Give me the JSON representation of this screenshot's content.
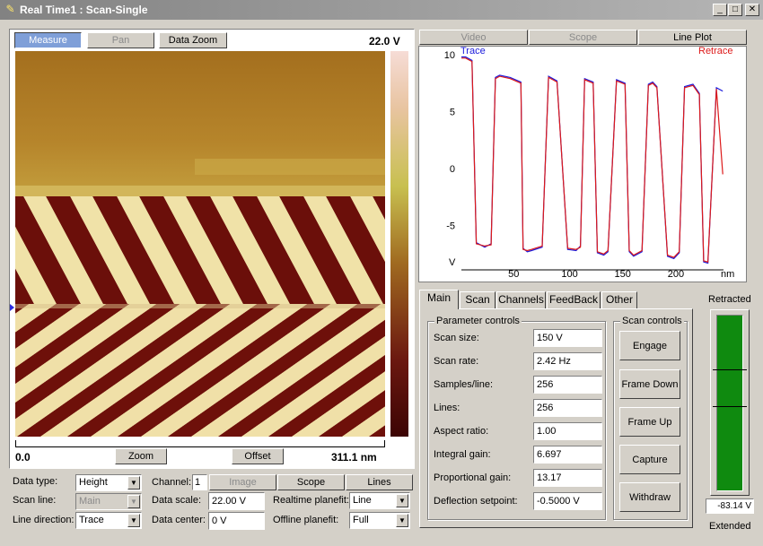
{
  "window": {
    "title": "Real Time1 : Scan-Single",
    "controls": {
      "minimize": "_",
      "maximize": "□",
      "close": "✕"
    }
  },
  "image_panel": {
    "buttons": [
      "Measure",
      "Pan",
      "Data Zoom"
    ],
    "scale_top": "22.0 V",
    "x_start": "0.0",
    "x_end": "311.1 nm",
    "zoom_button": "Zoom",
    "offset_button": "Offset"
  },
  "bottom_controls": {
    "data_type": {
      "label": "Data type:",
      "value": "Height"
    },
    "scan_line": {
      "label": "Scan line:",
      "value": "Main"
    },
    "line_direction": {
      "label": "Line direction:",
      "value": "Trace"
    },
    "channel": {
      "label": "Channel:",
      "value": "1"
    },
    "buttons": [
      "Image",
      "Scope",
      "Lines"
    ],
    "data_scale": {
      "label": "Data scale:",
      "value": "22.00 V"
    },
    "data_center": {
      "label": "Data center:",
      "value": "0 V"
    },
    "realtime_planefit": {
      "label": "Realtime planefit:",
      "value": "Line"
    },
    "offline_planefit": {
      "label": "Offline planefit:",
      "value": "Full"
    }
  },
  "plot_panel": {
    "view_tabs": [
      "Video",
      "Scope",
      "Line Plot"
    ],
    "trace_label": "Trace",
    "retrace_label": "Retrace",
    "x_unit": "nm"
  },
  "chart_data": {
    "type": "line",
    "xlabel": "nm",
    "ylabel": "V",
    "xlim": [
      0,
      311.1
    ],
    "ylim": [
      -8.5,
      10
    ],
    "x_ticks": [
      50,
      100,
      150,
      200
    ],
    "y_ticks": [
      10,
      5,
      0,
      -5
    ],
    "legend": "top",
    "colors": {
      "trace": "#1a1adc",
      "retrace": "#dd1a1a"
    },
    "series": [
      {
        "name": "Trace",
        "x": [
          0,
          4,
          10,
          14,
          22,
          28,
          32,
          36,
          46,
          56,
          58,
          62,
          66,
          76,
          82,
          86,
          90,
          100,
          108,
          112,
          116,
          124,
          128,
          134,
          138,
          146,
          154,
          158,
          162,
          170,
          176,
          180,
          184,
          194,
          200,
          205,
          210,
          218,
          224,
          228,
          232,
          240,
          246
        ],
        "y": [
          9.8,
          9.8,
          9.5,
          -6.5,
          -6.9,
          -6.6,
          8.0,
          8.2,
          8.0,
          7.6,
          -7.0,
          -7.3,
          -7.2,
          -6.9,
          8.1,
          7.9,
          7.7,
          -7.1,
          -7.2,
          -6.8,
          7.9,
          7.6,
          -7.4,
          -7.6,
          -7.3,
          7.8,
          7.5,
          -7.3,
          -7.7,
          -7.3,
          7.4,
          7.6,
          7.2,
          -7.7,
          -7.9,
          -7.4,
          7.2,
          7.4,
          6.6,
          -8.2,
          -8.3,
          7.1,
          6.8
        ]
      },
      {
        "name": "Retrace",
        "x": [
          0,
          4,
          10,
          14,
          22,
          28,
          32,
          36,
          46,
          56,
          58,
          62,
          66,
          76,
          82,
          86,
          90,
          100,
          108,
          112,
          116,
          124,
          128,
          134,
          138,
          146,
          154,
          158,
          162,
          170,
          176,
          180,
          184,
          194,
          200,
          205,
          210,
          218,
          224,
          228,
          232,
          240,
          246
        ],
        "y": [
          9.7,
          9.7,
          9.4,
          -6.6,
          -6.8,
          -6.7,
          7.9,
          8.1,
          7.9,
          7.5,
          -7.1,
          -7.2,
          -7.1,
          -6.8,
          8.0,
          7.8,
          7.6,
          -7.0,
          -7.1,
          -6.9,
          7.8,
          7.5,
          -7.3,
          -7.5,
          -7.2,
          7.7,
          7.4,
          -7.2,
          -7.6,
          -7.2,
          7.3,
          7.5,
          7.1,
          -7.6,
          -7.8,
          -7.3,
          7.1,
          7.3,
          6.5,
          -8.1,
          -8.2,
          7.0,
          -0.5
        ]
      }
    ]
  },
  "params_panel": {
    "tabs": [
      "Main",
      "Scan",
      "Channels",
      "FeedBack",
      "Other"
    ],
    "group_title": "Parameter controls",
    "params": [
      {
        "label": "Scan size:",
        "value": "150 V"
      },
      {
        "label": "Scan rate:",
        "value": "2.42 Hz"
      },
      {
        "label": "Samples/line:",
        "value": "256"
      },
      {
        "label": "Lines:",
        "value": "256"
      },
      {
        "label": "Aspect ratio:",
        "value": "1.00"
      },
      {
        "label": "Integral gain:",
        "value": "6.697"
      },
      {
        "label": "Proportional gain:",
        "value": "13.17"
      },
      {
        "label": "Deflection setpoint:",
        "value": "-0.5000 V"
      }
    ],
    "scan_group_title": "Scan controls",
    "scan_buttons": [
      "Engage",
      "Frame Down",
      "Frame Up",
      "Capture",
      "Withdraw"
    ]
  },
  "z_gauge": {
    "top_label": "Retracted",
    "bottom_label": "Extended",
    "value_text": "-83.14 V",
    "bar_color": "#0f8a0f",
    "fill_fraction": 1.0
  }
}
